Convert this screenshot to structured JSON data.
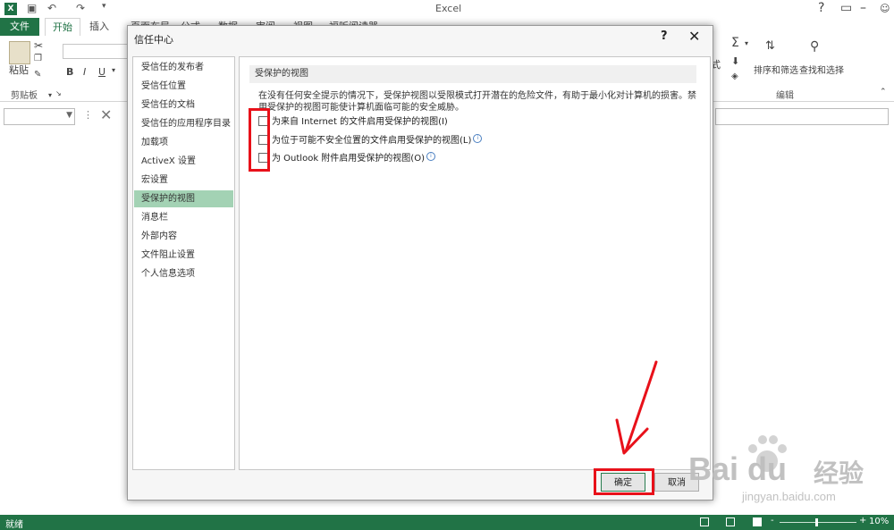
{
  "app": {
    "title": "Excel",
    "logo": "X",
    "file_tab": "文件",
    "tabs": [
      "开始",
      "插入",
      "页面布局",
      "公式",
      "数据",
      "审阅",
      "视图",
      "福昕阅读器"
    ],
    "active_tab": "开始",
    "ribbon": {
      "paste_label": "粘贴",
      "clipboard_group": "剪贴板",
      "bold": "B",
      "italic": "I",
      "underline": "U",
      "sort_filter": "排序和筛选",
      "find_select": "查找和选择",
      "edit_group": "编辑"
    },
    "status_text": "就绪",
    "zoom": "10%",
    "zoom_minus": "-",
    "zoom_plus": "+"
  },
  "dialog": {
    "title": "信任中心",
    "help": "?",
    "close": "✕",
    "nav": [
      "受信任的发布者",
      "受信任位置",
      "受信任的文档",
      "受信任的应用程序目录",
      "加载项",
      "ActiveX 设置",
      "宏设置",
      "受保护的视图",
      "消息栏",
      "外部内容",
      "文件阻止设置",
      "个人信息选项"
    ],
    "selected_nav": 7,
    "section_header": "受保护的视图",
    "description": "在没有任何安全提示的情况下，受保护视图以受限模式打开潜在的危险文件，有助于最小化对计算机的损害。禁用受保护的视图可能使计算机面临可能的安全威胁。",
    "options": [
      {
        "label": "为来自 Internet 的文件启用受保护的视图(I)",
        "checked": false,
        "info": false
      },
      {
        "label": "为位于可能不安全位置的文件启用受保护的视图(L)",
        "checked": false,
        "info": true
      },
      {
        "label": "为 Outlook 附件启用受保护的视图(O)",
        "checked": false,
        "info": true
      }
    ],
    "ok_label": "确定",
    "cancel_label": "取消"
  },
  "annotation_color": "#e8111a",
  "brand_color": "#217346",
  "watermark": {
    "logo": "Bai du",
    "cn": "经验",
    "url": "jingyan.baidu.com"
  }
}
